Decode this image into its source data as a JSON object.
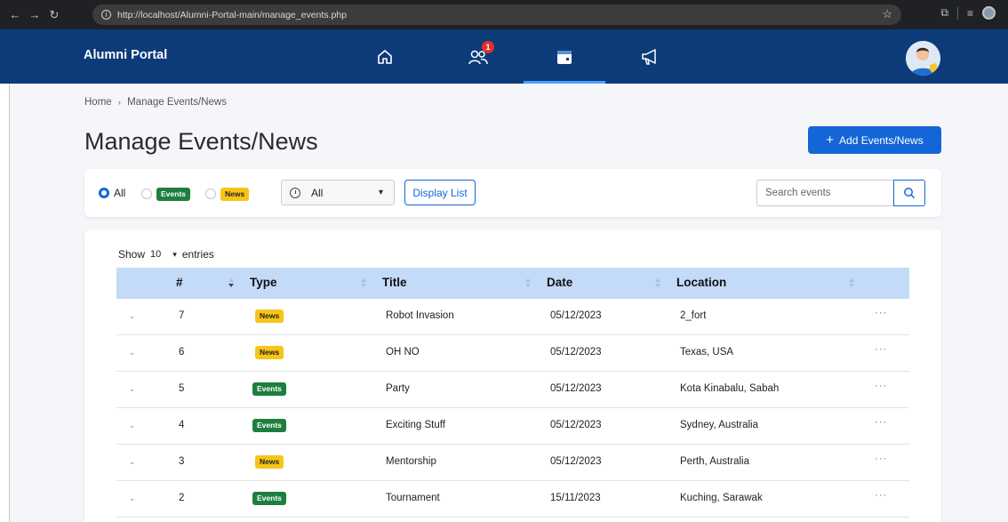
{
  "browser": {
    "url": "http://localhost/Alumni-Portal-main/manage_events.php"
  },
  "navbar": {
    "brand": "Alumni Portal",
    "notification_count": "1",
    "items": [
      {
        "icon": "home-icon"
      },
      {
        "icon": "users-icon"
      },
      {
        "icon": "calendar-icon",
        "active": true
      },
      {
        "icon": "megaphone-icon"
      }
    ]
  },
  "page": {
    "breadcrumb_home": "Home",
    "breadcrumb_separator": "›",
    "breadcrumb_current": "Manage Events/News",
    "title": "Manage Events/News",
    "add_button": "Add Events/News"
  },
  "filters": {
    "radio_all": "All",
    "radio_events": "Events",
    "radio_news": "News",
    "time_select_value": "All",
    "display_button": "Display List",
    "search_placeholder": "Search events"
  },
  "table": {
    "show_label": "Show",
    "page_size": "10",
    "entries_label": "entries",
    "columns": [
      "#",
      "Type",
      "Title",
      "Date",
      "Location"
    ],
    "rows": [
      {
        "num": "7",
        "type": "News",
        "title": "Robot Invasion",
        "date": "05/12/2023",
        "location": "2_fort"
      },
      {
        "num": "6",
        "type": "News",
        "title": "OH NO",
        "date": "05/12/2023",
        "location": "Texas, USA"
      },
      {
        "num": "5",
        "type": "Events",
        "title": "Party",
        "date": "05/12/2023",
        "location": "Kota Kinabalu, Sabah"
      },
      {
        "num": "4",
        "type": "Events",
        "title": "Exciting Stuff",
        "date": "05/12/2023",
        "location": "Sydney, Australia"
      },
      {
        "num": "3",
        "type": "News",
        "title": "Mentorship",
        "date": "05/12/2023",
        "location": "Perth, Australia"
      },
      {
        "num": "2",
        "type": "Events",
        "title": "Tournament",
        "date": "15/11/2023",
        "location": "Kuching, Sarawak"
      }
    ],
    "more_label": "···"
  },
  "colors": {
    "navbar": "#0d3b7a",
    "primary": "#1466d6",
    "events_tag": "#1e7e3e",
    "news_tag": "#f8c418",
    "table_header": "#c4daf9"
  }
}
